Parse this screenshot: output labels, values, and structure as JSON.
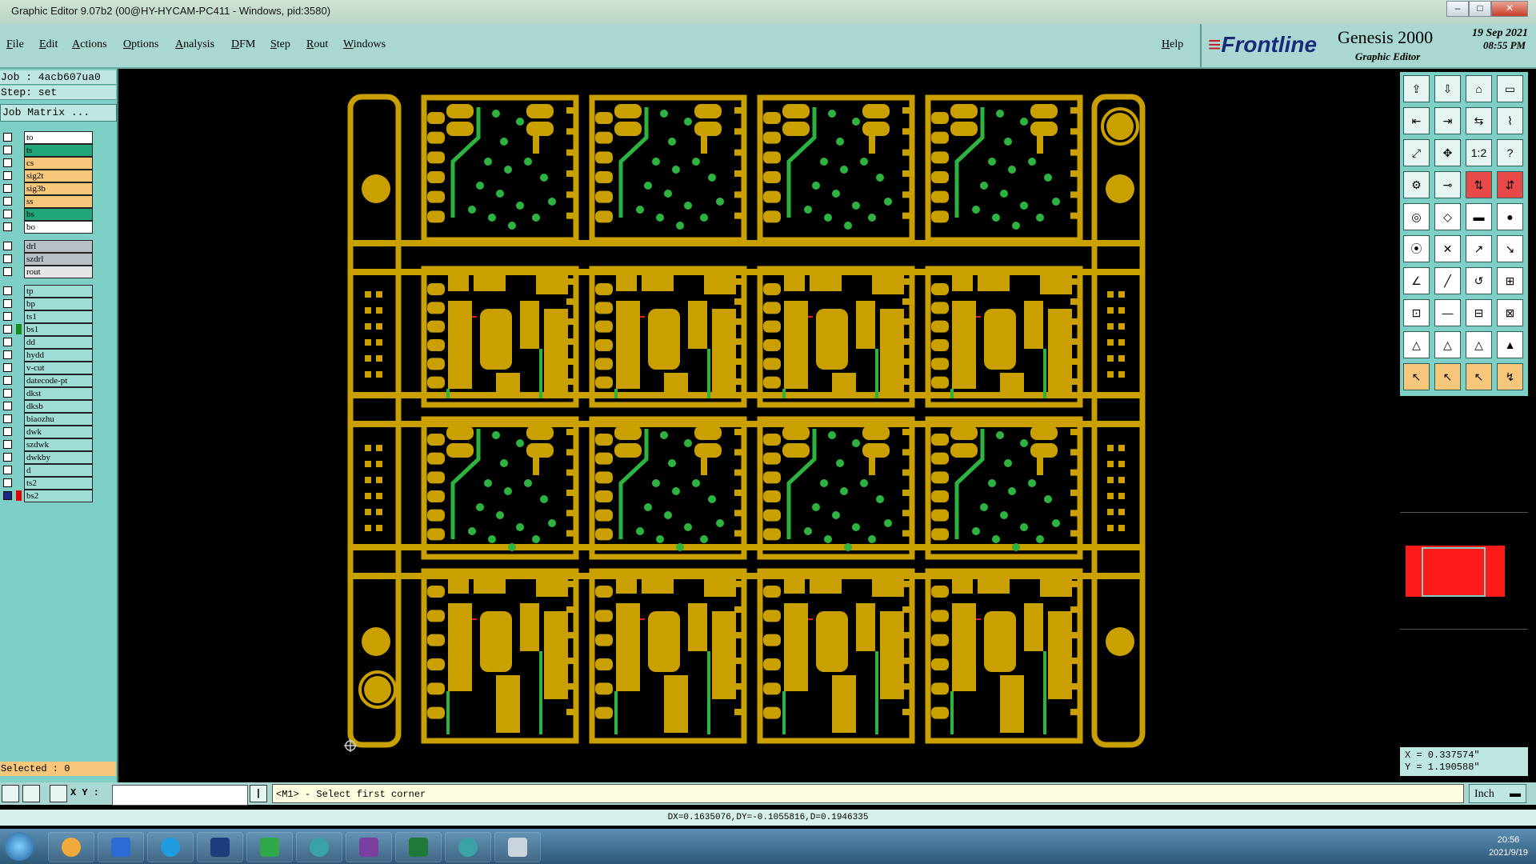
{
  "window": {
    "title": "Graphic Editor 9.07b2 (00@HY-HYCAM-PC411 - Windows, pid:3580)"
  },
  "menu": [
    "File",
    "Edit",
    "Actions",
    "Options",
    "Analysis",
    "DFM",
    "Step",
    "Rout",
    "Windows"
  ],
  "help": "Help",
  "brand": {
    "logo": "Frontline",
    "product": "Genesis 2000",
    "subtitle": "Graphic Editor",
    "date": "19 Sep 2021",
    "time": "08:55 PM"
  },
  "job": {
    "job_label": "Job : 4acb607ua0",
    "step_label": "Step: set",
    "matrix_label": "Job Matrix ..."
  },
  "layers": [
    {
      "name": "to",
      "color": "#ffffff"
    },
    {
      "name": "ts",
      "color": "#1fa67a"
    },
    {
      "name": "cs",
      "color": "#f6c77a"
    },
    {
      "name": "sig2t",
      "color": "#f6c77a"
    },
    {
      "name": "sig3b",
      "color": "#f6c77a"
    },
    {
      "name": "ss",
      "color": "#f6c77a"
    },
    {
      "name": "bs",
      "color": "#1fa67a"
    },
    {
      "name": "bo",
      "color": "#ffffff"
    },
    {
      "gap": true
    },
    {
      "name": "drl",
      "color": "#b8c0c6"
    },
    {
      "name": "szdrl",
      "color": "#b8c0c6"
    },
    {
      "name": "rout",
      "color": "#e6e6e6"
    },
    {
      "gap": true
    },
    {
      "name": "tp",
      "color": "#9fded6"
    },
    {
      "name": "bp",
      "color": "#9fded6"
    },
    {
      "name": "ts1",
      "color": "#9fded6"
    },
    {
      "name": "bs1",
      "color": "#9fded6",
      "swatch": "#1a8a1a"
    },
    {
      "name": "dd",
      "color": "#9fded6"
    },
    {
      "name": "hydd",
      "color": "#9fded6"
    },
    {
      "name": "v-cut",
      "color": "#9fded6"
    },
    {
      "name": "datecode-pt",
      "color": "#9fded6"
    },
    {
      "name": "dkst",
      "color": "#9fded6"
    },
    {
      "name": "dksb",
      "color": "#9fded6"
    },
    {
      "name": "biaozhu",
      "color": "#9fded6"
    },
    {
      "name": "dwk",
      "color": "#9fded6"
    },
    {
      "name": "szdwk",
      "color": "#9fded6"
    },
    {
      "name": "dwkby",
      "color": "#9fded6"
    },
    {
      "name": "d",
      "color": "#9fded6"
    },
    {
      "name": "ts2",
      "color": "#9fded6"
    },
    {
      "name": "bs2",
      "color": "#9fded6",
      "swatch": "#e00000",
      "checked": true
    }
  ],
  "selected": "Selected : 0",
  "coords": {
    "x": "X = 0.337574\"",
    "y": "Y = 1.190588\""
  },
  "status": {
    "xy_label": "X Y :",
    "prompt": "<M1> - Select first corner",
    "unit": "Inch",
    "measure": "DX=0.1635076,DY=-0.1055816,D=0.1946335"
  },
  "clock": {
    "time": "20:56",
    "date": "2021/9/19"
  },
  "colors": {
    "copper": "#c9a000",
    "mask": "#2db33f",
    "panel": "#7ecfc6"
  }
}
